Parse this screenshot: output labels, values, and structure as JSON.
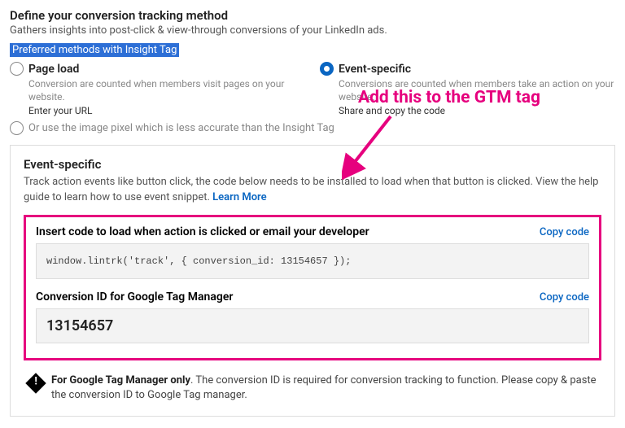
{
  "header": {
    "title": "Define your conversion tracking method",
    "subtitle": "Gathers insights into post-click & view-through conversions of your LinkedIn ads."
  },
  "preferred_label": "Preferred methods with Insight Tag",
  "methods": {
    "pageload": {
      "label": "Page load",
      "desc": "Conversion are counted when members visit pages on your website.",
      "hint": "Enter your URL"
    },
    "eventspecific": {
      "label": "Event-specific",
      "desc": "Conversions are counted when members take an action on your website.",
      "hint": "Share and copy the code"
    }
  },
  "alt_method": "Or use the image pixel which is less accurate than the Insight Tag",
  "annotation": "Add this to the GTM tag",
  "panel": {
    "title": "Event-specific",
    "desc": "Track action events like button click, the code below needs to be installed to load when that button is clicked. View the help guide to learn how to use event snippet. ",
    "learn_more": "Learn More"
  },
  "code": {
    "snippet_label": "Insert code to load when action is clicked or email your developer",
    "snippet": "window.lintrk('track', { conversion_id: 13154657 });",
    "id_label": "Conversion ID for Google Tag Manager",
    "conversion_id": "13154657",
    "copy": "Copy code"
  },
  "gtm_note": {
    "bold": "For Google Tag Manager only",
    "rest": ". The conversion ID is required for conversion tracking to function. Please copy & paste the conversion ID to Google Tag manager."
  }
}
